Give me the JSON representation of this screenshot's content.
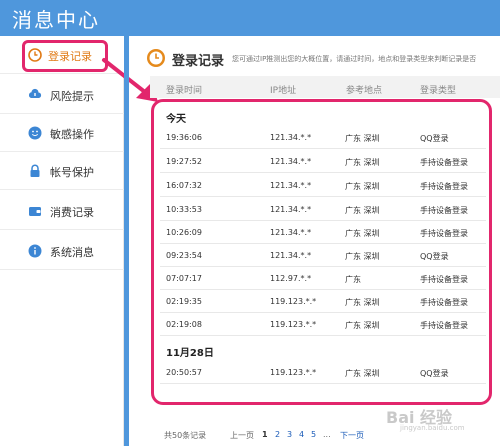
{
  "app": {
    "title": "消息中心"
  },
  "sidebar": {
    "items": [
      {
        "label": "登录记录",
        "icon": "clock-icon"
      },
      {
        "label": "风险提示",
        "icon": "cloud-warning-icon"
      },
      {
        "label": "敏感操作",
        "icon": "smiley-icon"
      },
      {
        "label": "帐号保护",
        "icon": "lock-icon"
      },
      {
        "label": "消费记录",
        "icon": "wallet-icon"
      },
      {
        "label": "系统消息",
        "icon": "info-icon"
      }
    ]
  },
  "main": {
    "title": "登录记录",
    "description": "您可通过IP推测出您的大概位置，请通过时间，地点和登录类型来判断记录是否",
    "columns": [
      "登录时间",
      "IP地址",
      "参考地点",
      "登录类型"
    ],
    "groups": [
      {
        "label": "今天",
        "rows": [
          [
            "19:36:06",
            "121.34.*.*",
            "广东 深圳",
            "QQ登录"
          ],
          [
            "19:27:52",
            "121.34.*.*",
            "广东 深圳",
            "手持设备登录"
          ],
          [
            "16:07:32",
            "121.34.*.*",
            "广东 深圳",
            "手持设备登录"
          ],
          [
            "10:33:53",
            "121.34.*.*",
            "广东 深圳",
            "手持设备登录"
          ],
          [
            "10:26:09",
            "121.34.*.*",
            "广东 深圳",
            "手持设备登录"
          ],
          [
            "09:23:54",
            "121.34.*.*",
            "广东 深圳",
            "QQ登录"
          ],
          [
            "07:07:17",
            "112.97.*.*",
            "广东",
            "手持设备登录"
          ],
          [
            "02:19:35",
            "119.123.*.*",
            "广东 深圳",
            "手持设备登录"
          ],
          [
            "02:19:08",
            "119.123.*.*",
            "广东 深圳",
            "手持设备登录"
          ]
        ]
      },
      {
        "label": "11月28日",
        "rows": [
          [
            "20:50:57",
            "119.123.*.*",
            "广东 深圳",
            "QQ登录"
          ]
        ]
      }
    ]
  },
  "pager": {
    "total": "共50条记录",
    "prev": "上一页",
    "pages": [
      "1",
      "2",
      "3",
      "4",
      "5"
    ],
    "ellipsis": "...",
    "next": "下一页"
  },
  "watermark": {
    "text": "Bai 经验",
    "site": "jingyan.baidu.com"
  },
  "colors": {
    "accent": "#4f97dc",
    "highlight": "#e2266c",
    "active_text": "#e07a16"
  }
}
